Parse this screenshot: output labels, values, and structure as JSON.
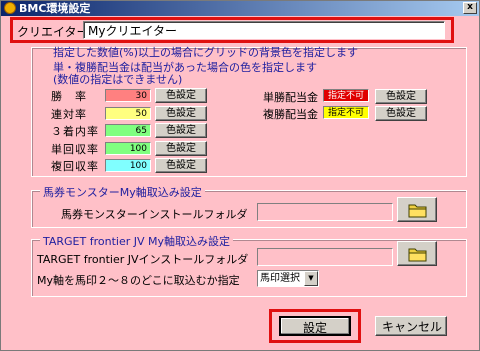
{
  "window": {
    "title": "BMC環境設定",
    "close_glyph": "x"
  },
  "creator": {
    "label": "クリエイター名",
    "value": "Myクリエイター"
  },
  "grid_group": {
    "note1": "指定した数値(%)以上の場合にグリッドの背景色を指定します",
    "note2": "単・複勝配当金は配当があった場合の色を指定します",
    "note3": "(数値の指定はできません)",
    "rows": [
      {
        "label": "勝　率",
        "value": "30",
        "color": "#ff8080",
        "button": "色設定"
      },
      {
        "label": "連対率",
        "value": "50",
        "color": "#ffff80",
        "button": "色設定"
      },
      {
        "label": "３着内率",
        "value": "65",
        "color": "#80ff80",
        "button": "色設定"
      },
      {
        "label": "単回収率",
        "value": "100",
        "color": "#80ff80",
        "button": "色設定"
      },
      {
        "label": "複回収率",
        "value": "100",
        "color": "#80ffff",
        "button": "色設定"
      }
    ],
    "payout": [
      {
        "label": "単勝配当金",
        "badge": "指定不可",
        "color": "#e00000",
        "text_color": "#ffffff",
        "button": "色設定"
      },
      {
        "label": "複勝配当金",
        "badge": "指定不可",
        "color": "#ffff00",
        "text_color": "#000000",
        "button": "色設定"
      }
    ]
  },
  "monster_group": {
    "title": "馬券モンスターMy軸取込み設定",
    "folder_label": "馬券モンスターインストールフォルダ",
    "folder_value": ""
  },
  "target_group": {
    "title": "TARGET frontier JV My軸取込み設定",
    "folder_label": "TARGET frontier JVインストールフォルダ",
    "folder_value": "",
    "import_label": "My軸を馬印２～８のどこに取込むか指定",
    "select_value": "馬印選択"
  },
  "footer": {
    "ok_label": "設定",
    "cancel_label": "キャンセル"
  },
  "colors": {
    "highlight": "#e01010",
    "background": "#ffc0c8",
    "note_text": "#2020a0"
  }
}
